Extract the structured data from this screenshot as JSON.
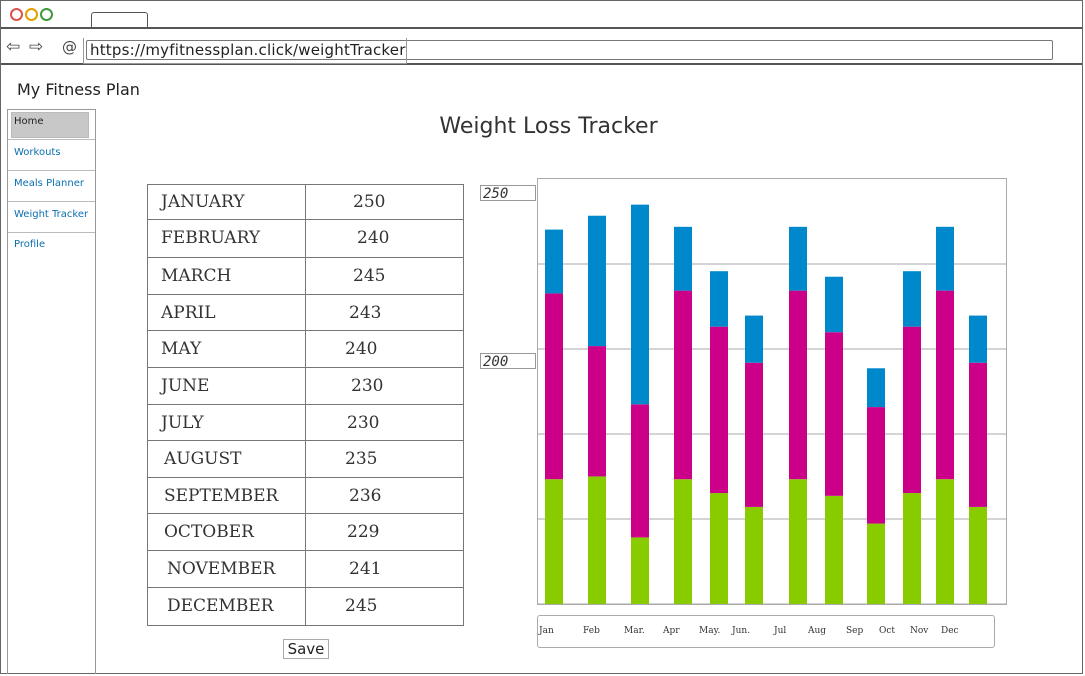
{
  "browser": {
    "url": "https://myfitnessplan.click/weightTracker",
    "back_icon": "back-arrow-icon",
    "forward_icon": "forward-arrow-icon",
    "reload_icon": "reload-icon"
  },
  "app": {
    "title": "My Fitness Plan"
  },
  "sidebar": {
    "items": [
      {
        "label": "Home"
      },
      {
        "label": "Workouts"
      },
      {
        "label": "Meals Planner"
      },
      {
        "label": "Weight Tracker"
      },
      {
        "label": "Profile"
      }
    ]
  },
  "page": {
    "title": "Weight Loss Tracker",
    "save_label": "Save"
  },
  "table": {
    "rows": [
      {
        "month": "JANUARY",
        "value": "250"
      },
      {
        "month": "FEBRUARY",
        "value": "240"
      },
      {
        "month": "MARCH",
        "value": "245"
      },
      {
        "month": "APRIL",
        "value": "243"
      },
      {
        "month": "MAY",
        "value": "240"
      },
      {
        "month": "JUNE",
        "value": "230"
      },
      {
        "month": "JULY",
        "value": "230"
      },
      {
        "month": "AUGUST",
        "value": "235"
      },
      {
        "month": "SEPTEMBER",
        "value": "236"
      },
      {
        "month": "OCTOBER",
        "value": "229"
      },
      {
        "month": "NOVEMBER",
        "value": "241"
      },
      {
        "month": "DECEMBER",
        "value": "245"
      }
    ]
  },
  "chart_data": {
    "type": "bar",
    "stacked": true,
    "categories": [
      "Jan",
      "Feb",
      "Mar.",
      "Apr",
      "May.",
      "Jun.",
      "Jul",
      "Aug",
      "Sep",
      "Oct",
      "Nov",
      "Dec"
    ],
    "y_tick_labels": [
      "250",
      "200"
    ],
    "ylim": [
      100,
      250
    ],
    "grid": true,
    "series": [
      {
        "color": "#88cc00",
        "values": [
          145,
          146,
          124,
          145,
          140,
          135,
          145,
          139,
          129,
          140,
          145,
          135
        ]
      },
      {
        "color": "#cc0088",
        "values": [
          67,
          47,
          48,
          68,
          60,
          52,
          68,
          59,
          42,
          60,
          68,
          52
        ]
      },
      {
        "color": "#0088cc",
        "values": [
          23,
          47,
          72,
          23,
          20,
          17,
          23,
          20,
          14,
          20,
          23,
          17
        ]
      }
    ]
  }
}
